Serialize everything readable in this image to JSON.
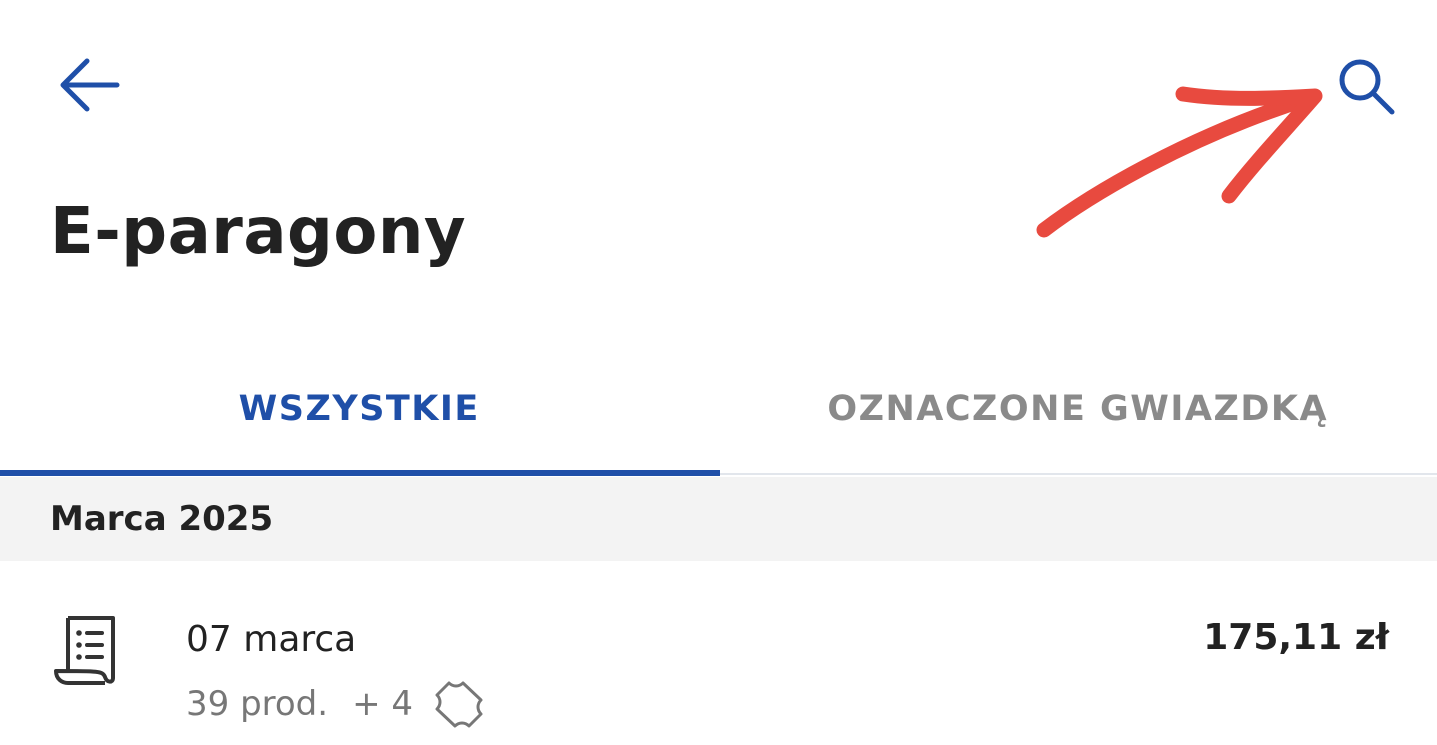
{
  "header": {
    "back_icon": "arrow-left-icon",
    "search_icon": "search-icon",
    "annotation": "red-arrow-pointing-to-search"
  },
  "page": {
    "title": "E-paragony"
  },
  "tabs": [
    {
      "label": "WSZYSTKIE",
      "active": true
    },
    {
      "label": "OZNACZONE GWIAZDKĄ",
      "active": false
    }
  ],
  "month_group": {
    "label": "Marca 2025"
  },
  "receipts": [
    {
      "date": "07 marca",
      "products": "39 prod.",
      "extra": "+ 4",
      "coupon_icon": "coupon-icon",
      "amount": "175,11 zł"
    }
  ],
  "colors": {
    "accent": "#1f4fa8",
    "annotation": "#e84a3f",
    "text": "#222222",
    "muted": "#777777",
    "inactive_tab": "#8a8a8a",
    "section_bg": "#f3f3f3"
  }
}
